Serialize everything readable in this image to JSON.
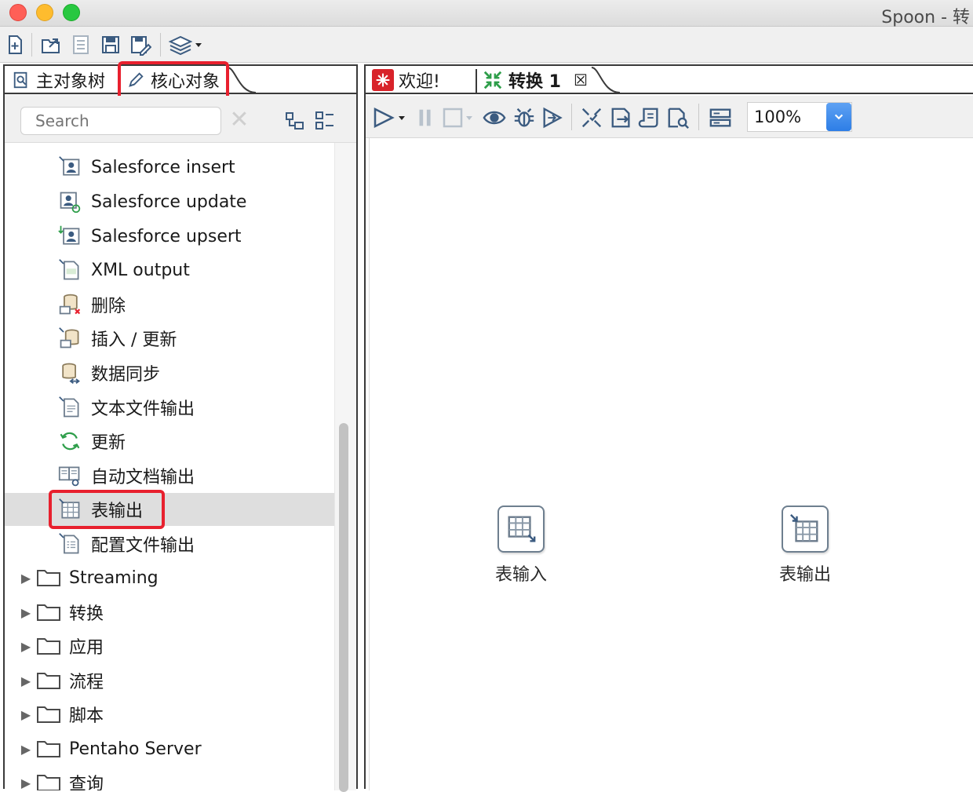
{
  "window": {
    "title": "Spoon - 转"
  },
  "toolbar": {
    "buttons": [
      "new-file-icon",
      "open-file-icon",
      "explore-repo-icon",
      "save-icon",
      "save-as-icon",
      "perspective-icon"
    ]
  },
  "left_panel": {
    "tabs": [
      {
        "label": "主对象树",
        "icon": "view-tree-icon",
        "active": false
      },
      {
        "label": "核心对象",
        "icon": "pencil-icon",
        "active": true,
        "highlighted": true
      }
    ],
    "search": {
      "placeholder": "Search"
    },
    "steps": [
      {
        "label": "Salesforce insert",
        "icon": "salesforce-insert-icon"
      },
      {
        "label": "Salesforce update",
        "icon": "salesforce-update-icon"
      },
      {
        "label": "Salesforce upsert",
        "icon": "salesforce-upsert-icon"
      },
      {
        "label": "XML output",
        "icon": "xml-output-icon"
      },
      {
        "label": "删除",
        "icon": "delete-db-icon"
      },
      {
        "label": "插入 / 更新",
        "icon": "insert-update-icon"
      },
      {
        "label": "数据同步",
        "icon": "sync-data-icon"
      },
      {
        "label": "文本文件输出",
        "icon": "text-file-output-icon"
      },
      {
        "label": "更新",
        "icon": "update-refresh-icon"
      },
      {
        "label": "自动文档输出",
        "icon": "auto-doc-output-icon"
      },
      {
        "label": "表输出",
        "icon": "table-output-icon",
        "selected": true,
        "highlighted": true
      },
      {
        "label": "配置文件输出",
        "icon": "properties-output-icon"
      }
    ],
    "folders": [
      {
        "label": "Streaming"
      },
      {
        "label": "转换"
      },
      {
        "label": "应用"
      },
      {
        "label": "流程"
      },
      {
        "label": "脚本"
      },
      {
        "label": "Pentaho Server"
      },
      {
        "label": "查询"
      }
    ]
  },
  "right_panel": {
    "tabs": [
      {
        "label": "欢迎!",
        "icon": "welcome-icon"
      },
      {
        "label": "转换 1",
        "icon": "transformation-icon",
        "active": true,
        "closable": true
      }
    ],
    "zoom": {
      "value": "100%"
    },
    "canvas_nodes": [
      {
        "label": "表输入",
        "icon": "table-input-icon"
      },
      {
        "label": "表输出",
        "icon": "table-output-icon"
      }
    ]
  },
  "colors": {
    "highlight": "#e8202e",
    "accent": "#2d7ee6",
    "selected_row": "#dedede"
  }
}
